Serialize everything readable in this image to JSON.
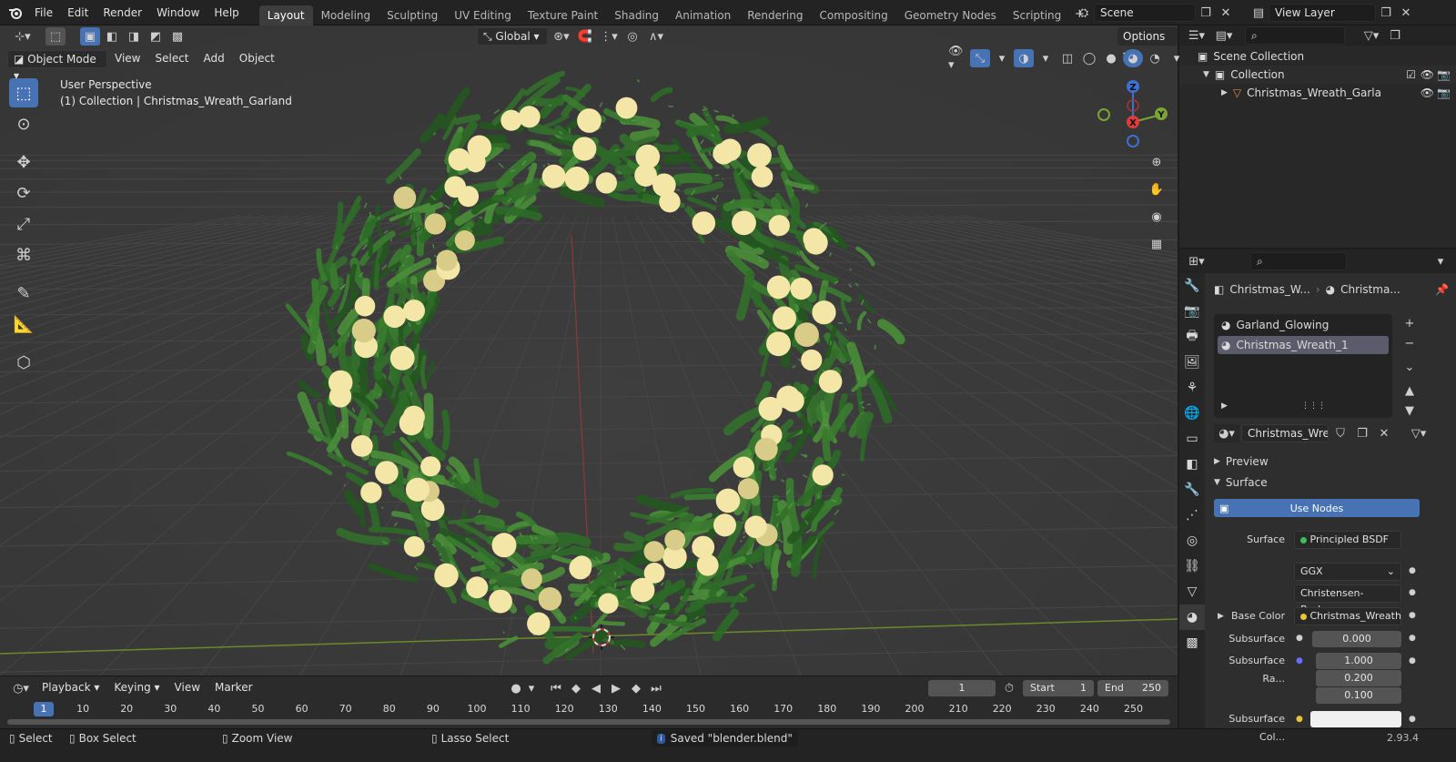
{
  "app": {
    "menu": [
      "File",
      "Edit",
      "Render",
      "Window",
      "Help"
    ],
    "workspaces": [
      "Layout",
      "Modeling",
      "Sculpting",
      "UV Editing",
      "Texture Paint",
      "Shading",
      "Animation",
      "Rendering",
      "Compositing",
      "Geometry Nodes",
      "Scripting"
    ],
    "active_workspace": "Layout",
    "scene": "Scene",
    "view_layer": "View Layer"
  },
  "viewport": {
    "transform_orientation": "Global",
    "options_label": "Options",
    "mode": "Object Mode",
    "header_menus": [
      "View",
      "Select",
      "Add",
      "Object"
    ],
    "perspective_text": "User Perspective",
    "collection_text": "(1) Collection | Christmas_Wreath_Garland",
    "gizmo_axes": {
      "z": "Z",
      "y": "Y",
      "x": "X"
    },
    "colors": {
      "accent": "#4772b3",
      "grid_x": "#8a3a3a",
      "grid_y": "#6a8a2a",
      "wreath": "#2f6b2a",
      "bulb": "#f3e6a6"
    }
  },
  "timeline": {
    "menus": [
      "Playback",
      "Keying",
      "View",
      "Marker"
    ],
    "current_frame": "1",
    "start_label": "Start",
    "start_value": "1",
    "end_label": "End",
    "end_value": "250",
    "ruler": [
      "1",
      "10",
      "20",
      "30",
      "40",
      "50",
      "60",
      "70",
      "80",
      "90",
      "100",
      "110",
      "120",
      "130",
      "140",
      "150",
      "160",
      "170",
      "180",
      "190",
      "200",
      "210",
      "220",
      "230",
      "240",
      "250"
    ]
  },
  "statusbar": {
    "select": "Select",
    "box_select": "Box Select",
    "zoom_view": "Zoom View",
    "lasso_select": "Lasso Select",
    "message": "Saved \"blender.blend\"",
    "version": "2.93.4"
  },
  "outliner": {
    "scene_collection": "Scene Collection",
    "collection": "Collection",
    "object": "Christmas_Wreath_Garla"
  },
  "properties": {
    "breadcrumb_object": "Christmas_W...",
    "breadcrumb_material": "Christma...",
    "material_slots": [
      "Garland_Glowing",
      "Christmas_Wreath_1"
    ],
    "active_slot": 1,
    "material_name": "Christmas_Wrea...",
    "panels": {
      "preview": "Preview",
      "surface": "Surface"
    },
    "use_nodes": "Use Nodes",
    "surface_label": "Surface",
    "surface_value": "Principled BSDF",
    "distribution": "GGX",
    "subsurface_method": "Christensen-Burley",
    "base_color_label": "Base Color",
    "base_color_value": "Christmas_Wreath...",
    "subsurface_label": "Subsurface",
    "subsurface_value": "0.000",
    "subsurface_radius_label": "Subsurface Ra...",
    "subsurface_radius": [
      "1.000",
      "0.200",
      "0.100"
    ],
    "subsurface_color_label": "Subsurface Col..."
  }
}
